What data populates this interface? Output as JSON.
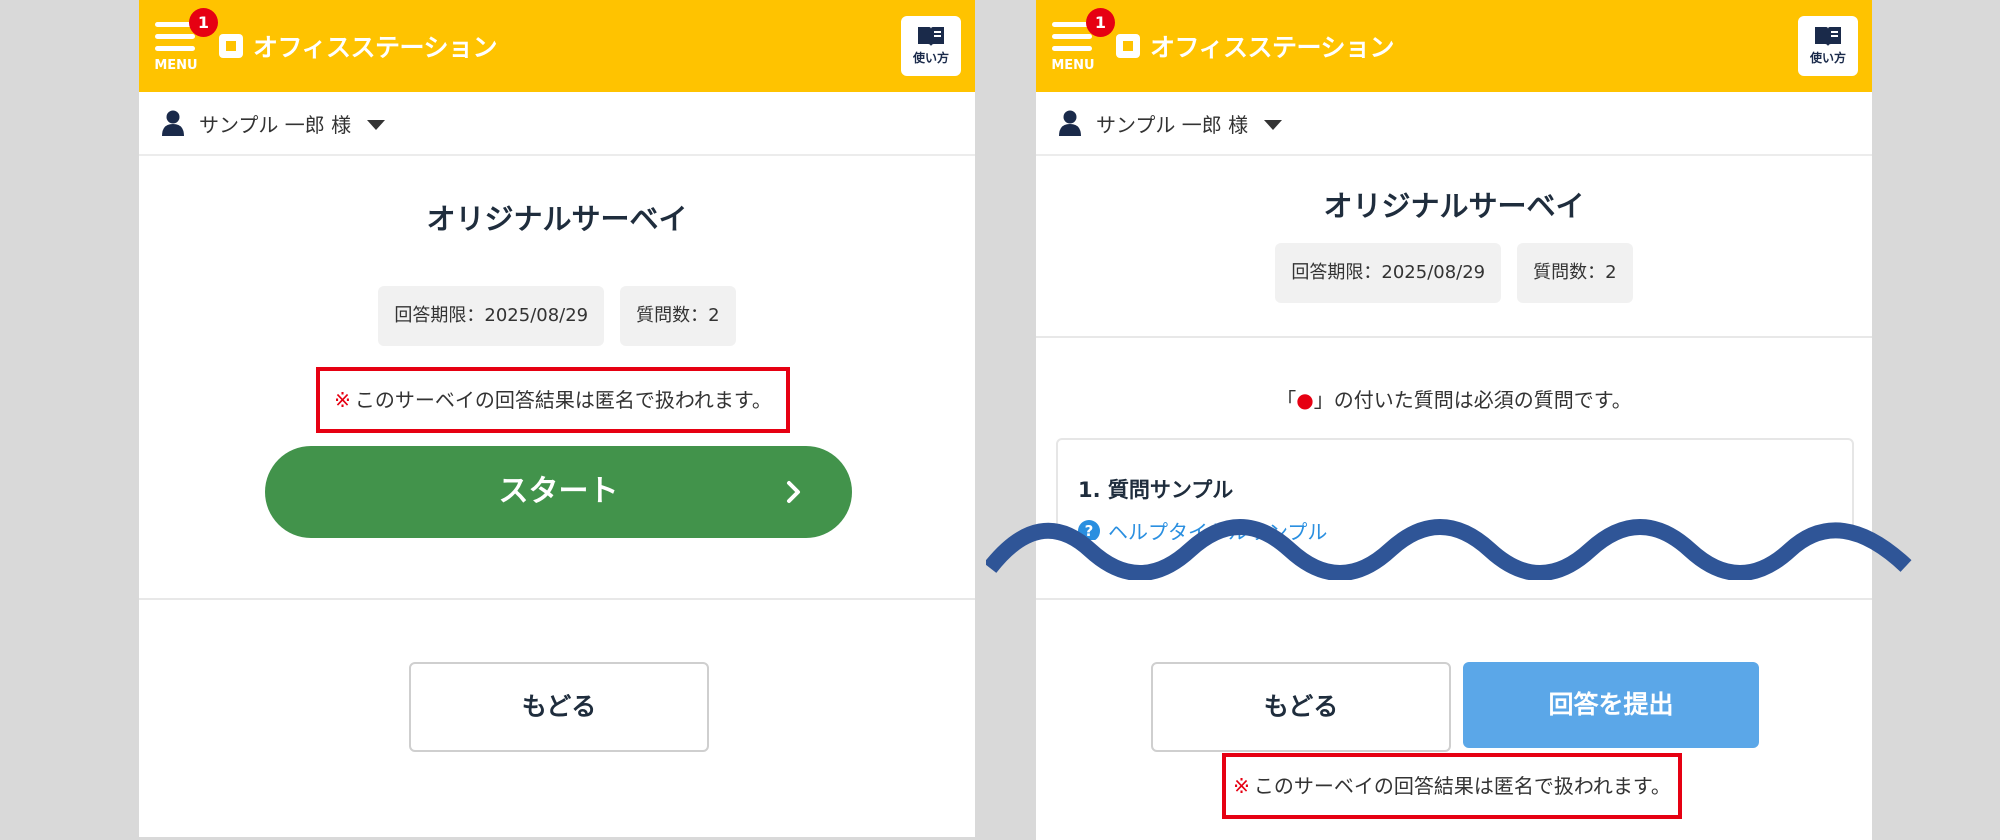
{
  "header": {
    "menu_label": "MENU",
    "notification_count": "1",
    "logo_text": "オフィスステーション",
    "guide_label": "使い方",
    "color": "#ffc300"
  },
  "user": {
    "name": "サンプル 一郎 様"
  },
  "left_screen": {
    "title": "オリジナルサーベイ",
    "deadline_chip": "回答期限：2025/08/29",
    "count_chip": "質問数：2",
    "notice_mark": "※",
    "notice_text": "このサーベイの回答結果は匿名で扱われます。",
    "start_label": "スタート",
    "back_label": "もどる"
  },
  "right_screen": {
    "title": "オリジナルサーベイ",
    "deadline_chip": "回答期限：2025/08/29",
    "count_chip": "質問数：2",
    "required_note_before": "「",
    "required_note_dot": "●",
    "required_note_after": "」の付いた質問は必須の質問です。",
    "question_title": "1.  質問サンプル",
    "help_icon": "?",
    "help_link": "ヘルプタイトルサンプル",
    "back_label": "もどる",
    "submit_label": "回答を提出",
    "notice_mark": "※",
    "notice_text": "このサーベイの回答結果は匿名で扱われます。"
  },
  "colors": {
    "start_button": "#42934b",
    "submit_button": "#5ba7e8",
    "notice_border": "#e60012",
    "wave": "#2f5597"
  }
}
